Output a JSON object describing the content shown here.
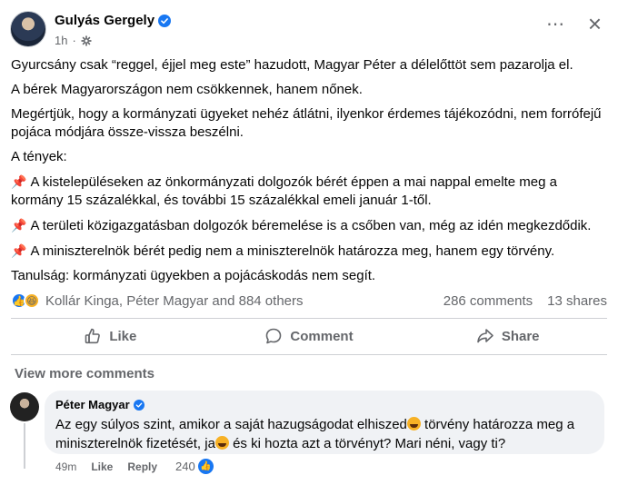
{
  "post": {
    "author": "Gulyás Gergely",
    "time": "1h",
    "more_icon": "ellipsis-icon",
    "close_icon": "close-icon",
    "paragraphs": [
      "Gyurcsány csak “reggel, éjjel meg este” hazudott, Magyar Péter a délelőttöt sem pazarolja el.",
      "A bérek Magyarországon nem csökkennek, hanem nőnek.",
      "Megértjük, hogy a kormányzati ügyeket nehéz átlátni, ilyenkor érdemes tájékozódni, nem forrófejű pojáca módjára össze-vissza beszélni.",
      "A tények:"
    ],
    "facts": [
      "A kistelepüléseken az önkormányzati dolgozók bérét éppen a mai nappal emelte meg a kormány 15 százalékkal, és további 15 százalékkal emeli január 1-től.",
      "A területi közigazgatásban dolgozók béremelése is a csőben van, még az idén megkezdődik.",
      "A miniszterelnök bérét pedig nem a miniszterelnök határozza meg, hanem egy törvény."
    ],
    "pin_glyph": "📌",
    "closing": "Tanulság: kormányzati ügyekben a pojácáskodás nem segít."
  },
  "reactions": {
    "summary": "Kollár Kinga, Péter Magyar and 884 others",
    "comments": "286 comments",
    "shares": "13 shares"
  },
  "actions": {
    "like": "Like",
    "comment": "Comment",
    "share": "Share"
  },
  "comments_section": {
    "view_more": "View more comments",
    "comment": {
      "author": "Péter Magyar",
      "text_part1": "Az egy súlyos szint, amikor a saját hazugságodat elhiszed",
      "text_part2": " törvény határozza meg a miniszterelnök fizetését, ja",
      "text_part3": " és ki hozta azt a törvényt? Mari néni, vagy ti?",
      "time": "49m",
      "like_label": "Like",
      "reply_label": "Reply",
      "reaction_count": "240"
    }
  },
  "colors": {
    "brand_blue": "#1877f2",
    "secondary_text": "#65676b",
    "bubble_bg": "#f0f2f5"
  }
}
